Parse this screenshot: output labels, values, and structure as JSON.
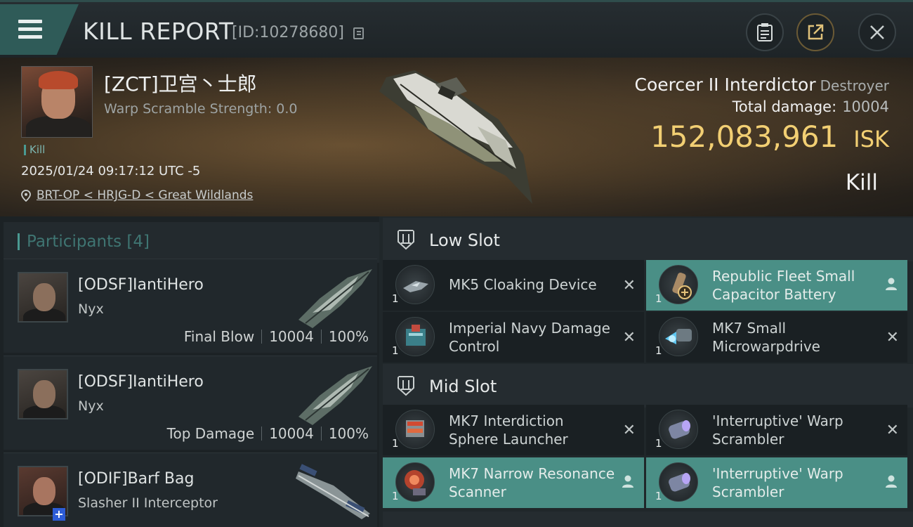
{
  "topbar": {
    "title": "KILL REPORT",
    "report_id": "[ID:10278680]"
  },
  "victim": {
    "pilot": "[ZCT]卫宫丶士郎",
    "warp_scramble": "Warp Scramble Strength: 0.0",
    "tag": "Kill",
    "datetime": "2025/01/24 09:17:12 UTC -5",
    "location": "BRT-OP < HRJG-D < Great Wildlands",
    "ship_name": "Coercer II Interdictor",
    "ship_class": "Destroyer",
    "total_damage_label": "Total damage:",
    "total_damage": "10004",
    "isk_value": "152,083,961",
    "isk_unit": "ISK",
    "result": "Kill"
  },
  "participants": {
    "header": "Participants [4]",
    "rows": [
      {
        "name": "[ODSF]IantiHero",
        "ship": "Nyx",
        "role": "Final Blow",
        "damage": "10004",
        "percent": "100%"
      },
      {
        "name": "[ODSF]IantiHero",
        "ship": "Nyx",
        "role": "Top Damage",
        "damage": "10004",
        "percent": "100%"
      },
      {
        "name": "[ODIF]Barf Bag",
        "ship": "Slasher II Interceptor"
      }
    ]
  },
  "slots": {
    "low": {
      "title": "Low Slot",
      "modules": [
        {
          "name": "MK5 Cloaking Device",
          "qty": "1"
        },
        {
          "name": "Republic Fleet Small Capacitor Battery",
          "qty": "1"
        },
        {
          "name": "Imperial Navy Damage Control",
          "qty": "1"
        },
        {
          "name": "MK7 Small Microwarpdrive",
          "qty": "1"
        }
      ]
    },
    "mid": {
      "title": "Mid Slot",
      "modules": [
        {
          "name": "MK7 Interdiction Sphere Launcher",
          "qty": "1"
        },
        {
          "name": "'Interruptive' Warp Scrambler",
          "qty": "1"
        },
        {
          "name": "MK7 Narrow Resonance Scanner",
          "qty": "1"
        },
        {
          "name": "'Interruptive' Warp Scrambler",
          "qty": "1"
        }
      ]
    }
  },
  "colors": {
    "accent": "#4a8f86",
    "isk": "#f2cf73"
  }
}
